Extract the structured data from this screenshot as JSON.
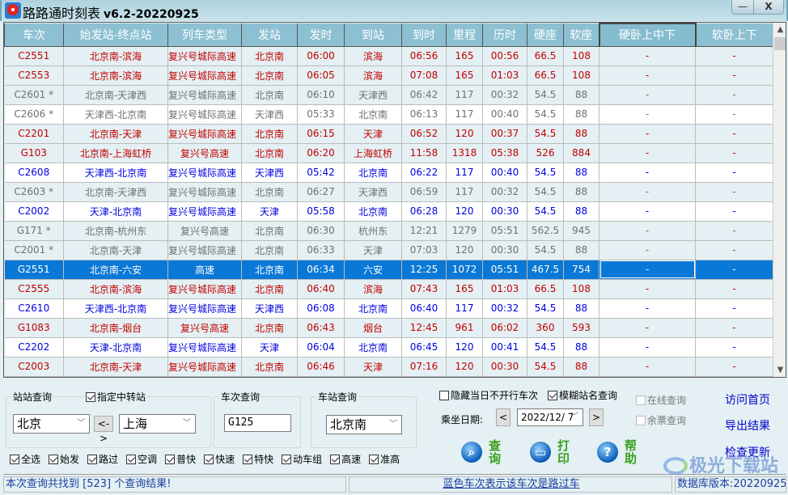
{
  "window": {
    "title": "路路通时刻表",
    "version": "v6.2-20220925",
    "minimize_glyph": "—",
    "close_glyph": "X"
  },
  "colors": {
    "header_bg": "#8cc0d2",
    "selected_row": "#0a78d6",
    "red_text": "#c40000",
    "blue_text": "#0000e0",
    "gray_text": "#707070"
  },
  "table": {
    "columns": [
      "车次",
      "始发站-终点站",
      "列车类型",
      "发站",
      "发时",
      "到站",
      "到时",
      "里程",
      "历时",
      "硬座",
      "软座",
      "硬卧上中下",
      "软卧上下"
    ],
    "rows": [
      {
        "train": "C2551",
        "route": "北京南-滨海",
        "type": "复兴号城际高速",
        "from": "北京南",
        "dep": "06:00",
        "to": "滨海",
        "arr": "06:56",
        "km": "165",
        "dur": "00:56",
        "hard_seat": "66.5",
        "soft_seat": "108",
        "hard_sleeper": "-",
        "soft_sleeper": "-",
        "color": "red"
      },
      {
        "train": "C2553",
        "route": "北京南-滨海",
        "type": "复兴号城际高速",
        "from": "北京南",
        "dep": "06:05",
        "to": "滨海",
        "arr": "07:08",
        "km": "165",
        "dur": "01:03",
        "hard_seat": "66.5",
        "soft_seat": "108",
        "hard_sleeper": "-",
        "soft_sleeper": "-",
        "color": "red"
      },
      {
        "train": "C2601 *",
        "route": "北京南-天津西",
        "type": "复兴号城际高速",
        "from": "北京南",
        "dep": "06:10",
        "to": "天津西",
        "arr": "06:42",
        "km": "117",
        "dur": "00:32",
        "hard_seat": "54.5",
        "soft_seat": "88",
        "hard_sleeper": "-",
        "soft_sleeper": "-",
        "color": "gray"
      },
      {
        "train": "C2606 *",
        "route": "天津西-北京南",
        "type": "复兴号城际高速",
        "from": "天津西",
        "dep": "05:33",
        "to": "北京南",
        "arr": "06:13",
        "km": "117",
        "dur": "00:40",
        "hard_seat": "54.5",
        "soft_seat": "88",
        "hard_sleeper": "-",
        "soft_sleeper": "-",
        "color": "gray"
      },
      {
        "train": "C2201",
        "route": "北京南-天津",
        "type": "复兴号城际高速",
        "from": "北京南",
        "dep": "06:15",
        "to": "天津",
        "arr": "06:52",
        "km": "120",
        "dur": "00:37",
        "hard_seat": "54.5",
        "soft_seat": "88",
        "hard_sleeper": "-",
        "soft_sleeper": "-",
        "color": "red"
      },
      {
        "train": "G103",
        "route": "北京南-上海虹桥",
        "type": "复兴号高速",
        "from": "北京南",
        "dep": "06:20",
        "to": "上海虹桥",
        "arr": "11:58",
        "km": "1318",
        "dur": "05:38",
        "hard_seat": "526",
        "soft_seat": "884",
        "hard_sleeper": "-",
        "soft_sleeper": "-",
        "color": "red"
      },
      {
        "train": "C2608",
        "route": "天津西-北京南",
        "type": "复兴号城际高速",
        "from": "天津西",
        "dep": "05:42",
        "to": "北京南",
        "arr": "06:22",
        "km": "117",
        "dur": "00:40",
        "hard_seat": "54.5",
        "soft_seat": "88",
        "hard_sleeper": "-",
        "soft_sleeper": "-",
        "color": "blue"
      },
      {
        "train": "C2603 *",
        "route": "北京南-天津西",
        "type": "复兴号城际高速",
        "from": "北京南",
        "dep": "06:27",
        "to": "天津西",
        "arr": "06:59",
        "km": "117",
        "dur": "00:32",
        "hard_seat": "54.5",
        "soft_seat": "88",
        "hard_sleeper": "-",
        "soft_sleeper": "-",
        "color": "gray"
      },
      {
        "train": "C2002",
        "route": "天津-北京南",
        "type": "复兴号城际高速",
        "from": "天津",
        "dep": "05:58",
        "to": "北京南",
        "arr": "06:28",
        "km": "120",
        "dur": "00:30",
        "hard_seat": "54.5",
        "soft_seat": "88",
        "hard_sleeper": "-",
        "soft_sleeper": "-",
        "color": "blue"
      },
      {
        "train": "G171 *",
        "route": "北京南-杭州东",
        "type": "复兴号高速",
        "from": "北京南",
        "dep": "06:30",
        "to": "杭州东",
        "arr": "12:21",
        "km": "1279",
        "dur": "05:51",
        "hard_seat": "562.5",
        "soft_seat": "945",
        "hard_sleeper": "-",
        "soft_sleeper": "-",
        "color": "gray"
      },
      {
        "train": "C2001 *",
        "route": "北京南-天津",
        "type": "复兴号城际高速",
        "from": "北京南",
        "dep": "06:33",
        "to": "天津",
        "arr": "07:03",
        "km": "120",
        "dur": "00:30",
        "hard_seat": "54.5",
        "soft_seat": "88",
        "hard_sleeper": "-",
        "soft_sleeper": "-",
        "color": "gray"
      },
      {
        "train": "G2551",
        "route": "北京南-六安",
        "type": "高速",
        "from": "北京南",
        "dep": "06:34",
        "to": "六安",
        "arr": "12:25",
        "km": "1072",
        "dur": "05:51",
        "hard_seat": "467.5",
        "soft_seat": "754",
        "hard_sleeper": "-",
        "soft_sleeper": "-",
        "color": "selected"
      },
      {
        "train": "C2555",
        "route": "北京南-滨海",
        "type": "复兴号城际高速",
        "from": "北京南",
        "dep": "06:40",
        "to": "滨海",
        "arr": "07:43",
        "km": "165",
        "dur": "01:03",
        "hard_seat": "66.5",
        "soft_seat": "108",
        "hard_sleeper": "-",
        "soft_sleeper": "-",
        "color": "red"
      },
      {
        "train": "C2610",
        "route": "天津西-北京南",
        "type": "复兴号城际高速",
        "from": "天津西",
        "dep": "06:08",
        "to": "北京南",
        "arr": "06:40",
        "km": "117",
        "dur": "00:32",
        "hard_seat": "54.5",
        "soft_seat": "88",
        "hard_sleeper": "-",
        "soft_sleeper": "-",
        "color": "blue"
      },
      {
        "train": "G1083",
        "route": "北京南-烟台",
        "type": "复兴号高速",
        "from": "北京南",
        "dep": "06:43",
        "to": "烟台",
        "arr": "12:45",
        "km": "961",
        "dur": "06:02",
        "hard_seat": "360",
        "soft_seat": "593",
        "hard_sleeper": "-",
        "soft_sleeper": "-",
        "color": "red"
      },
      {
        "train": "C2202",
        "route": "天津-北京南",
        "type": "复兴号城际高速",
        "from": "天津",
        "dep": "06:04",
        "to": "北京南",
        "arr": "06:45",
        "km": "120",
        "dur": "00:41",
        "hard_seat": "54.5",
        "soft_seat": "88",
        "hard_sleeper": "-",
        "soft_sleeper": "-",
        "color": "blue"
      },
      {
        "train": "C2003",
        "route": "北京南-天津",
        "type": "复兴号城际高速",
        "from": "北京南",
        "dep": "06:46",
        "to": "天津",
        "arr": "07:16",
        "km": "120",
        "dur": "00:30",
        "hard_seat": "54.5",
        "soft_seat": "88",
        "hard_sleeper": "-",
        "soft_sleeper": "-",
        "color": "red"
      }
    ]
  },
  "station_query": {
    "label": "站站查询",
    "transfer_label": "指定中转站",
    "transfer_checked": true,
    "from_value": "北京",
    "swap_label": "<->",
    "to_value": "上海"
  },
  "train_query": {
    "label": "车次查询",
    "value": "G125"
  },
  "stop_query": {
    "label": "车站查询",
    "value": "北京南"
  },
  "options": {
    "hide_not_running_label": "隐藏当日不开行车次",
    "hide_not_running_checked": false,
    "fuzzy_label": "模糊站名查询",
    "fuzzy_checked": true,
    "date_label": "乘坐日期:",
    "date_prev": "<",
    "date_value": "2022/12/ 7",
    "date_next": ">",
    "online_label": "在线查询",
    "tickets_label": "余票查询"
  },
  "filters": [
    {
      "label": "全选",
      "checked": true
    },
    {
      "label": "始发",
      "checked": true
    },
    {
      "label": "路过",
      "checked": true
    },
    {
      "label": "空调",
      "checked": true
    },
    {
      "label": "普快",
      "checked": true
    },
    {
      "label": "快速",
      "checked": true
    },
    {
      "label": "特快",
      "checked": true
    },
    {
      "label": "动车组",
      "checked": true
    },
    {
      "label": "高速",
      "checked": true
    },
    {
      "label": "准高",
      "checked": true
    }
  ],
  "actions": {
    "query": "查询",
    "print": "打印",
    "help": "帮助",
    "help_glyph": "?"
  },
  "links": {
    "home": "访问首页",
    "export": "导出结果",
    "update": "检查更新"
  },
  "status": {
    "result_count": "本次查询共找到 [523] 个查询结果!",
    "legend": "蓝色车次表示该车次是路过车",
    "db_version": "数据库版本:20220925"
  },
  "watermark": "极光下载站"
}
